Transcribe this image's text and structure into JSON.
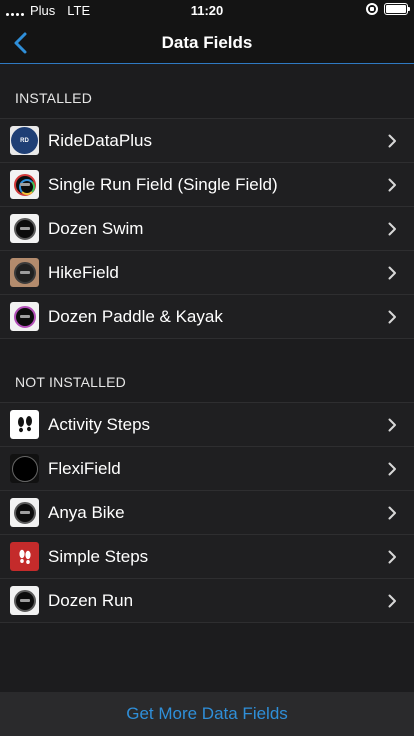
{
  "status_bar": {
    "carrier": "Plus",
    "network": "LTE",
    "time": "11:20"
  },
  "nav": {
    "title": "Data Fields",
    "back_icon": "chevron-left-icon"
  },
  "sections": {
    "installed": {
      "header": "INSTALLED",
      "items": [
        {
          "label": "RideDataPlus",
          "icon": "ridedataplus-icon"
        },
        {
          "label": "Single Run Field (Single Field)",
          "icon": "watch-face-icon"
        },
        {
          "label": "Dozen Swim",
          "icon": "watch-face-icon"
        },
        {
          "label": "HikeField",
          "icon": "watch-on-wrist-icon"
        },
        {
          "label": "Dozen Paddle & Kayak",
          "icon": "watch-face-icon"
        }
      ]
    },
    "not_installed": {
      "header": "NOT INSTALLED",
      "items": [
        {
          "label": "Activity Steps",
          "icon": "footprints-icon"
        },
        {
          "label": "FlexiField",
          "icon": "watch-face-icon"
        },
        {
          "label": "Anya Bike",
          "icon": "watch-face-icon"
        },
        {
          "label": "Simple Steps",
          "icon": "footprints-icon"
        },
        {
          "label": "Dozen Run",
          "icon": "watch-face-icon"
        }
      ]
    }
  },
  "footer": {
    "link_label": "Get More Data Fields"
  },
  "colors": {
    "accent": "#2f8fd9",
    "background": "#1c1c1e",
    "row_background": "#1f1f21"
  }
}
